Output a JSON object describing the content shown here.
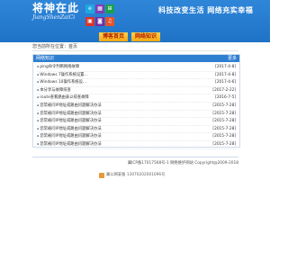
{
  "header": {
    "logo_main": "将神在此",
    "logo_sub": "JiangShenZaiCi",
    "slogan": "科技改变生活   网络充实幸福",
    "tiles": [
      {
        "color": "#1ea7e1",
        "glyph": "e"
      },
      {
        "color": "#7b3fb7",
        "glyph": "▦"
      },
      {
        "color": "#1aa150",
        "glyph": "⊞"
      },
      {
        "color": "#d9342b",
        "glyph": "▣"
      },
      {
        "color": "#6d2fa5",
        "glyph": "◙"
      },
      {
        "color": "#e4542a",
        "glyph": "♫"
      }
    ]
  },
  "nav": {
    "items": [
      {
        "label": "博客首页"
      },
      {
        "label": "网络知识"
      }
    ]
  },
  "breadcrumb": {
    "text": "您当前所在位置：首页"
  },
  "panel": {
    "title": "网络知识",
    "more": "更多",
    "items": [
      {
        "title": "ping命令判断网络故障",
        "date": "[2017-4-8]"
      },
      {
        "title": "Windows 7操作系统设置…",
        "date": "[2017-4-8]"
      },
      {
        "title": "Windows 10操作系统设…",
        "date": "[2017-4-6]"
      },
      {
        "title": "本分享与故障排查",
        "date": "[2017-2-22]"
      },
      {
        "title": "route查看路由表以排查故障",
        "date": "[2016-7-5]"
      },
      {
        "title": "您常被问IP地址或路由问题解决办法",
        "date": "[2015-7-28]"
      },
      {
        "title": "您常被问IP地址或路由问题解决办法",
        "date": "[2015-7-28]"
      },
      {
        "title": "您常被问IP地址或路由问题解决办法",
        "date": "[2015-7-28]"
      },
      {
        "title": "您常被问IP地址或路由问题解决办法",
        "date": "[2015-7-28]"
      },
      {
        "title": "您常被问IP地址或路由问题解决办法",
        "date": "[2015-7-28]"
      },
      {
        "title": "您常被问IP地址或路由问题解决办法",
        "date": "[2015-7-28]"
      }
    ]
  },
  "footer": {
    "text": "冀ICP备17017568号-1  网络维护网站  Copyright@2009-2018"
  },
  "beian": {
    "text": "冀公网安备 13070202001096号"
  }
}
